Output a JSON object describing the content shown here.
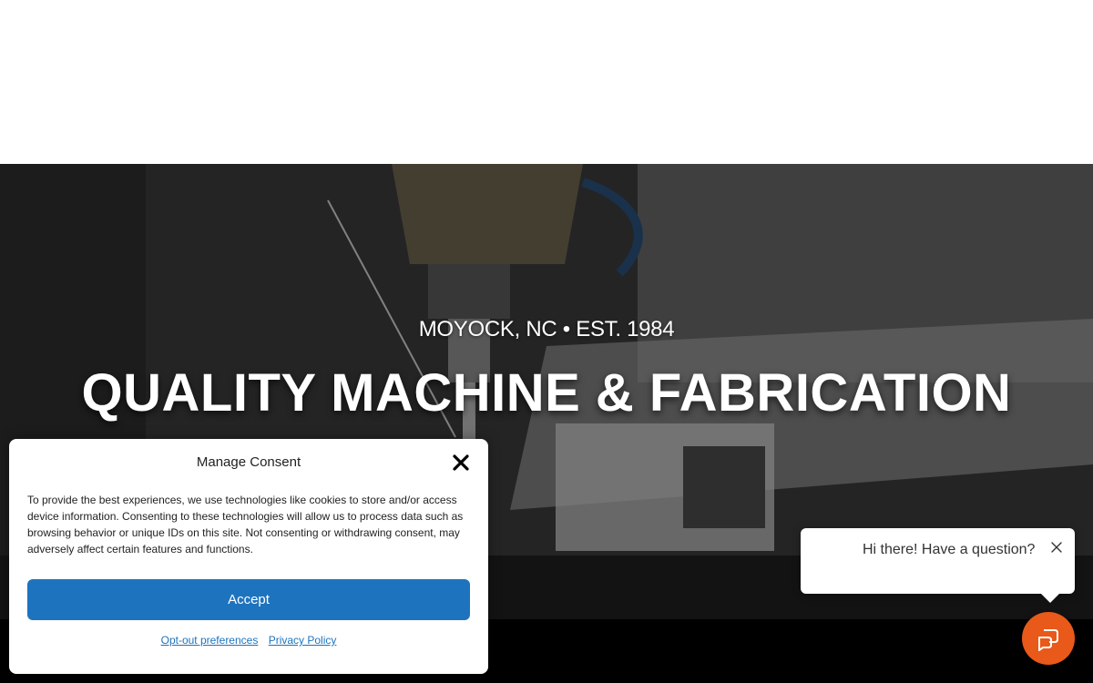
{
  "hero": {
    "subtitle": "MOYOCK, NC • EST. 1984",
    "title": "QUALITY MACHINE & FABRICATION"
  },
  "consent": {
    "title": "Manage Consent",
    "body": "To provide the best experiences, we use technologies like cookies to store and/or access device information. Consenting to these technologies will allow us to process data such as browsing behavior or unique IDs on this site. Not consenting or withdrawing consent, may adversely affect certain features and functions.",
    "accept_label": "Accept",
    "links": [
      "Opt-out preferences",
      "Privacy Policy"
    ],
    "accent_color": "#1e73be",
    "close_icon": "close-icon"
  },
  "chat": {
    "greeting": "Hi there! Have a question?",
    "launcher_color": "#e8591a",
    "launcher_icon": "chat-icon",
    "close_icon": "close-icon"
  }
}
